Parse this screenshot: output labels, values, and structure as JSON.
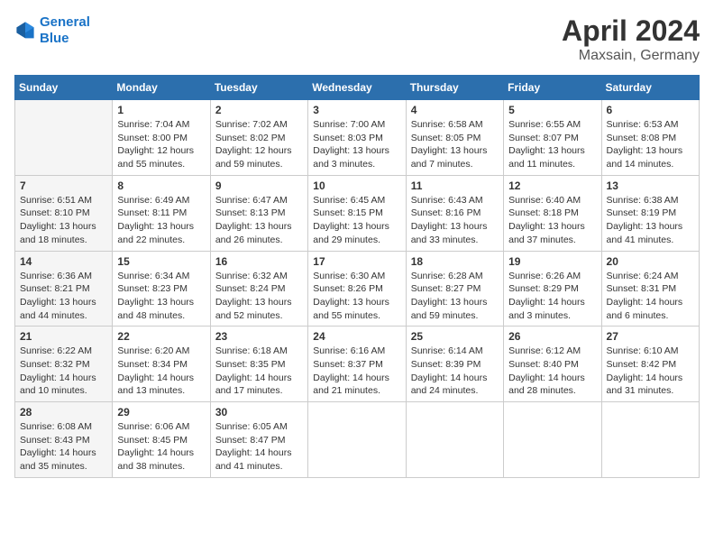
{
  "header": {
    "logo_line1": "General",
    "logo_line2": "Blue",
    "month": "April 2024",
    "location": "Maxsain, Germany"
  },
  "columns": [
    "Sunday",
    "Monday",
    "Tuesday",
    "Wednesday",
    "Thursday",
    "Friday",
    "Saturday"
  ],
  "weeks": [
    [
      {
        "day": "",
        "info": ""
      },
      {
        "day": "1",
        "info": "Sunrise: 7:04 AM\nSunset: 8:00 PM\nDaylight: 12 hours\nand 55 minutes."
      },
      {
        "day": "2",
        "info": "Sunrise: 7:02 AM\nSunset: 8:02 PM\nDaylight: 12 hours\nand 59 minutes."
      },
      {
        "day": "3",
        "info": "Sunrise: 7:00 AM\nSunset: 8:03 PM\nDaylight: 13 hours\nand 3 minutes."
      },
      {
        "day": "4",
        "info": "Sunrise: 6:58 AM\nSunset: 8:05 PM\nDaylight: 13 hours\nand 7 minutes."
      },
      {
        "day": "5",
        "info": "Sunrise: 6:55 AM\nSunset: 8:07 PM\nDaylight: 13 hours\nand 11 minutes."
      },
      {
        "day": "6",
        "info": "Sunrise: 6:53 AM\nSunset: 8:08 PM\nDaylight: 13 hours\nand 14 minutes."
      }
    ],
    [
      {
        "day": "7",
        "info": "Sunrise: 6:51 AM\nSunset: 8:10 PM\nDaylight: 13 hours\nand 18 minutes."
      },
      {
        "day": "8",
        "info": "Sunrise: 6:49 AM\nSunset: 8:11 PM\nDaylight: 13 hours\nand 22 minutes."
      },
      {
        "day": "9",
        "info": "Sunrise: 6:47 AM\nSunset: 8:13 PM\nDaylight: 13 hours\nand 26 minutes."
      },
      {
        "day": "10",
        "info": "Sunrise: 6:45 AM\nSunset: 8:15 PM\nDaylight: 13 hours\nand 29 minutes."
      },
      {
        "day": "11",
        "info": "Sunrise: 6:43 AM\nSunset: 8:16 PM\nDaylight: 13 hours\nand 33 minutes."
      },
      {
        "day": "12",
        "info": "Sunrise: 6:40 AM\nSunset: 8:18 PM\nDaylight: 13 hours\nand 37 minutes."
      },
      {
        "day": "13",
        "info": "Sunrise: 6:38 AM\nSunset: 8:19 PM\nDaylight: 13 hours\nand 41 minutes."
      }
    ],
    [
      {
        "day": "14",
        "info": "Sunrise: 6:36 AM\nSunset: 8:21 PM\nDaylight: 13 hours\nand 44 minutes."
      },
      {
        "day": "15",
        "info": "Sunrise: 6:34 AM\nSunset: 8:23 PM\nDaylight: 13 hours\nand 48 minutes."
      },
      {
        "day": "16",
        "info": "Sunrise: 6:32 AM\nSunset: 8:24 PM\nDaylight: 13 hours\nand 52 minutes."
      },
      {
        "day": "17",
        "info": "Sunrise: 6:30 AM\nSunset: 8:26 PM\nDaylight: 13 hours\nand 55 minutes."
      },
      {
        "day": "18",
        "info": "Sunrise: 6:28 AM\nSunset: 8:27 PM\nDaylight: 13 hours\nand 59 minutes."
      },
      {
        "day": "19",
        "info": "Sunrise: 6:26 AM\nSunset: 8:29 PM\nDaylight: 14 hours\nand 3 minutes."
      },
      {
        "day": "20",
        "info": "Sunrise: 6:24 AM\nSunset: 8:31 PM\nDaylight: 14 hours\nand 6 minutes."
      }
    ],
    [
      {
        "day": "21",
        "info": "Sunrise: 6:22 AM\nSunset: 8:32 PM\nDaylight: 14 hours\nand 10 minutes."
      },
      {
        "day": "22",
        "info": "Sunrise: 6:20 AM\nSunset: 8:34 PM\nDaylight: 14 hours\nand 13 minutes."
      },
      {
        "day": "23",
        "info": "Sunrise: 6:18 AM\nSunset: 8:35 PM\nDaylight: 14 hours\nand 17 minutes."
      },
      {
        "day": "24",
        "info": "Sunrise: 6:16 AM\nSunset: 8:37 PM\nDaylight: 14 hours\nand 21 minutes."
      },
      {
        "day": "25",
        "info": "Sunrise: 6:14 AM\nSunset: 8:39 PM\nDaylight: 14 hours\nand 24 minutes."
      },
      {
        "day": "26",
        "info": "Sunrise: 6:12 AM\nSunset: 8:40 PM\nDaylight: 14 hours\nand 28 minutes."
      },
      {
        "day": "27",
        "info": "Sunrise: 6:10 AM\nSunset: 8:42 PM\nDaylight: 14 hours\nand 31 minutes."
      }
    ],
    [
      {
        "day": "28",
        "info": "Sunrise: 6:08 AM\nSunset: 8:43 PM\nDaylight: 14 hours\nand 35 minutes."
      },
      {
        "day": "29",
        "info": "Sunrise: 6:06 AM\nSunset: 8:45 PM\nDaylight: 14 hours\nand 38 minutes."
      },
      {
        "day": "30",
        "info": "Sunrise: 6:05 AM\nSunset: 8:47 PM\nDaylight: 14 hours\nand 41 minutes."
      },
      {
        "day": "",
        "info": ""
      },
      {
        "day": "",
        "info": ""
      },
      {
        "day": "",
        "info": ""
      },
      {
        "day": "",
        "info": ""
      }
    ]
  ]
}
